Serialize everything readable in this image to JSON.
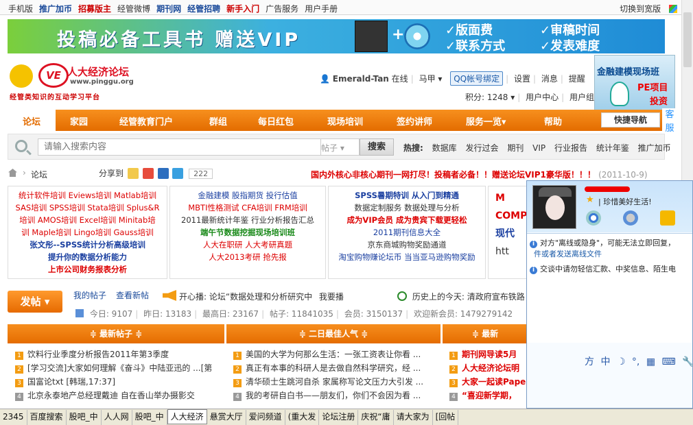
{
  "topbar": {
    "links": [
      {
        "label": "手机版",
        "style": "plain"
      },
      {
        "label": "推广加币",
        "style": "blue"
      },
      {
        "label": "招募版主",
        "style": "red"
      },
      {
        "label": "经管微博",
        "style": "plain"
      },
      {
        "label": "期刊网",
        "style": "blue"
      },
      {
        "label": "经管招聘",
        "style": "blue"
      },
      {
        "label": "新手入门",
        "style": "red"
      },
      {
        "label": "广告服务",
        "style": "plain"
      },
      {
        "label": "用户手册",
        "style": "plain"
      }
    ],
    "switch_label": "切换到宽版"
  },
  "banner": {
    "headline": "投稿必备工具书  赠送VIP",
    "features": [
      "✓版面费",
      "✓审稿时间",
      "✓联系方式",
      "✓发表难度"
    ]
  },
  "logo": {
    "name": "人大经济论坛",
    "url": "www.pinggu.org",
    "slogan": "经管类知识的互动学习平台"
  },
  "user": {
    "username": "Emerald-Tan",
    "status": "在线",
    "horse": "马甲",
    "qq_bind": "QQ帐号绑定",
    "settings": "设置",
    "messages": "消息",
    "remind": "提醒",
    "points": "积分: 1248",
    "center": "用户中心",
    "more": "用户组"
  },
  "ad_right": {
    "title": "金融建模现场班",
    "line2": "PE项目",
    "line3": "投资"
  },
  "service_tab": "客服",
  "nav": {
    "items": [
      "论坛",
      "家园",
      "经管教育门户",
      "群组",
      "每日红包",
      "现场培训",
      "签约讲师",
      "服务一览▾",
      "帮助"
    ],
    "quick": "快捷导航"
  },
  "search": {
    "placeholder": "请输入搜索内容",
    "scope": "帖子",
    "button": "搜索",
    "hot_label": "热搜:",
    "hot": [
      "数据库",
      "发行过会",
      "期刊",
      "VIP",
      "行业报告",
      "统计年鉴",
      "推广加币"
    ]
  },
  "crumb": {
    "forum": "论坛",
    "share_label": "分享到",
    "share_count": "222",
    "notice": "国内外核心非核心期刊一网打尽！投稿者必备！！赠送论坛VIP1豪华版！！！",
    "notice_date": "(2011-10-9)"
  },
  "box1": [
    {
      "t": "统计软件培训  Eviews培训  Matlab培训",
      "c": "r"
    },
    {
      "t": "SAS培训  SPSS培训  Stata培训  Splus&R",
      "c": "r"
    },
    {
      "t": "培训  AMOS培训  Excel培训  Minitab培",
      "c": "r"
    },
    {
      "t": "训  Maple培训  Lingo培训  Gauss培训",
      "c": "r"
    },
    {
      "t": "张文彤--SPSS统计分析高级培训",
      "c": "bl b"
    },
    {
      "t": "提升你的数据分析能力",
      "c": "bl b"
    },
    {
      "t": "上市公司财务报表分析",
      "c": "r b"
    }
  ],
  "box2": [
    {
      "t": "金融建模  股指期货  投行估值",
      "c": "bl"
    },
    {
      "t": "MBTI性格测试  CFA培训  FRM培训",
      "c": "r"
    },
    {
      "t": "2011最新统计年鉴  行业分析报告汇总",
      "c": "k"
    },
    {
      "t": "端午节数据挖掘现场培训班",
      "c": "g b"
    },
    {
      "t": "人大在职研  人大考研真题",
      "c": "r"
    },
    {
      "t": "人大2013考研  抢先报",
      "c": "r"
    }
  ],
  "box3": [
    {
      "t": "SPSS暑期特训  从入门到精通",
      "c": "bl b"
    },
    {
      "t": "数据定制服务  数据处理与分析",
      "c": "k"
    },
    {
      "t": "成为VIP会员  成为贵宾下载更轻松",
      "c": "r b"
    },
    {
      "t": "2011期刊信息大全",
      "c": "bl"
    },
    {
      "t": "京东商城购物奖励通道",
      "c": "k"
    },
    {
      "t": "淘宝购物赚论坛币  当当亚马逊购物奖励",
      "c": "bl"
    }
  ],
  "box4": [
    {
      "t": "M",
      "c": "r b"
    },
    {
      "t": "COMP",
      "c": "r b"
    },
    {
      "t": "现代",
      "c": "bl b"
    },
    {
      "t": "htt",
      "c": "k"
    }
  ],
  "posting": {
    "button": "发帖",
    "my_posts": "我的帖子",
    "latest": "查看新帖",
    "heart_label": "开心播:",
    "heart_text": "论坛“数据处理和分析研究中",
    "heart_action": "我要播",
    "history_label": "历史上的今天:",
    "history_text": "清政府宣布铁路"
  },
  "stats": {
    "today": "今日: 9107",
    "yesterday": "昨日: 13183",
    "max": "最高日: 23167",
    "threads": "帖子: 11841035",
    "members": "会员: 3150137",
    "welcome": "欢迎新会员: 1479279142"
  },
  "columns": {
    "h1": "最新帖子",
    "h2": "二日最佳人气",
    "h3": "最新",
    "col1": [
      "饮料行业季度分析报告2011年第3季度",
      "[学习交流]大家如何理解《奋斗》中陆亚迅的 ...[第",
      "国富论txt [韩瑞,17:37]",
      "北京永泰地产总经理戴迪  自在香山举办摄影交"
    ],
    "col2": [
      "美国的大学为何那么生活：一张工资表让你看 ...",
      "真正有本事的科研人是去做自然科学研究，经 ...",
      "清华硕士生跳河自杀  家属称写论文压力大引发 ...",
      "我的考研自白书——朋友们，你们不会因为看 ..."
    ],
    "col3": [
      "期刊网导读5月",
      "人大经济论坛明",
      "大家一起读Pape",
      "“喜迎新学期，"
    ]
  },
  "taskbar": [
    "2345",
    "百度搜索",
    "股吧_中",
    "人人网",
    "股吧_中",
    "人大经济",
    "悬赏大厅",
    "爱问频道",
    "(重大发",
    "论坛注册",
    "庆祝“庸",
    "请大家为",
    "[回帖"
  ],
  "chat": {
    "signature": "珍惜美好生活!",
    "line1": "对方\"离线或隐身\"，可能无法立即回复，",
    "line1b": "件或者",
    "line1c": "发送离线文件",
    "line2": "交谈中请勿轻信汇款、中奖信息、陌生电",
    "ime": [
      "方",
      "中",
      "☽",
      "°,",
      "▦",
      "⌨",
      "🔧"
    ]
  }
}
